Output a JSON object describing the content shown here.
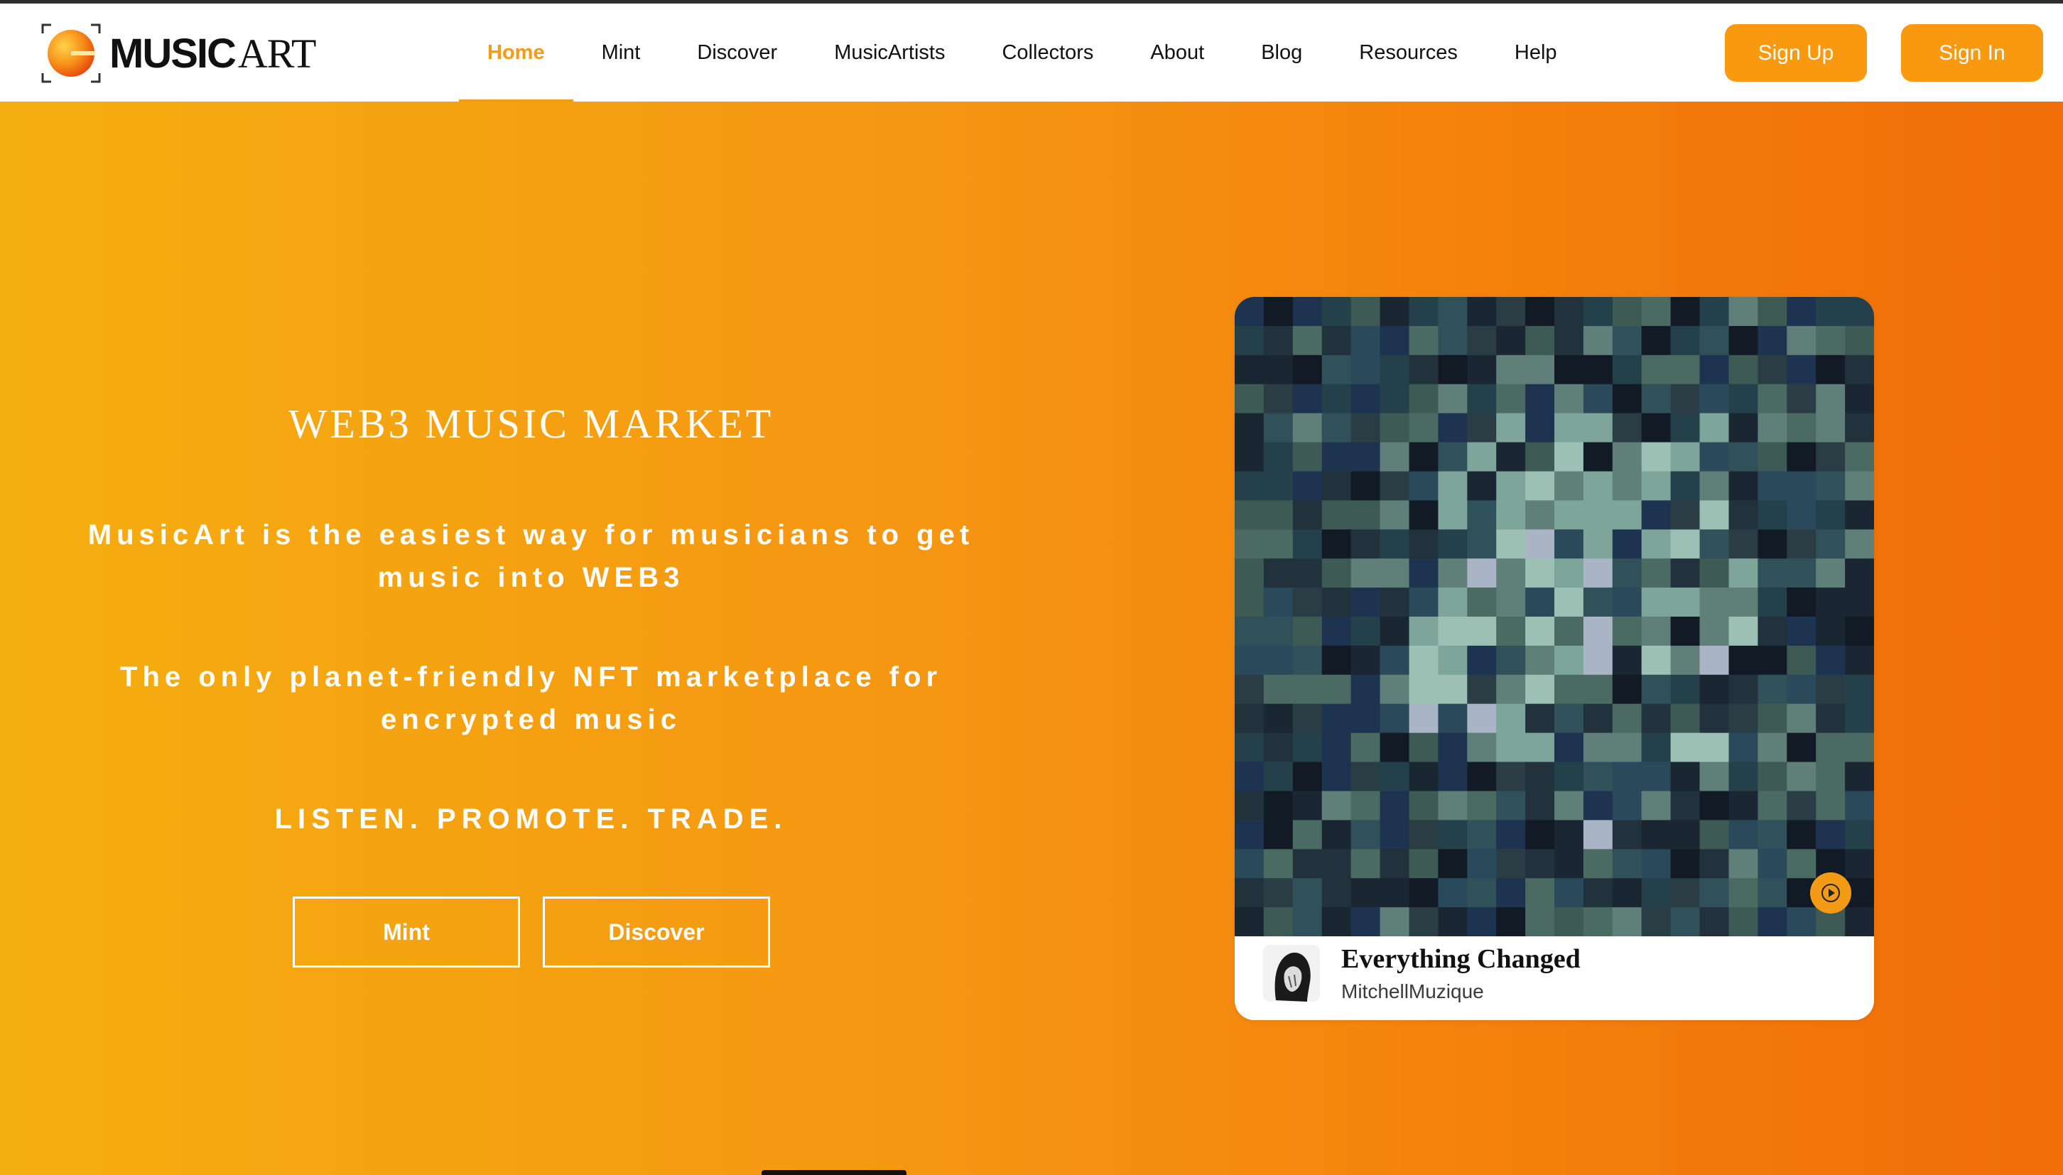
{
  "brand": {
    "name_part1": "MUSIC",
    "name_part2": "ART",
    "accent_color": "#f39a16"
  },
  "nav": {
    "items": [
      {
        "label": "Home",
        "active": true
      },
      {
        "label": "Mint"
      },
      {
        "label": "Discover"
      },
      {
        "label": "MusicArtists"
      },
      {
        "label": "Collectors"
      },
      {
        "label": "About"
      },
      {
        "label": "Blog"
      },
      {
        "label": "Resources"
      },
      {
        "label": "Help"
      }
    ]
  },
  "auth": {
    "signup_label": "Sign Up",
    "signin_label": "Sign In"
  },
  "hero": {
    "kicker": "WEB3 MUSIC MARKET",
    "lead1": "MusicArt is the easiest way for musicians to get music into WEB3",
    "lead2": "The only planet-friendly NFT marketplace for encrypted music",
    "lead3": "LISTEN. PROMOTE. TRADE.",
    "mint_label": "Mint",
    "discover_label": "Discover",
    "gradient": [
      "#f5ae10",
      "#f06d08"
    ]
  },
  "featured": {
    "title": "Everything Changed",
    "artist": "MitchellMuzique",
    "play_icon": "play-icon"
  }
}
